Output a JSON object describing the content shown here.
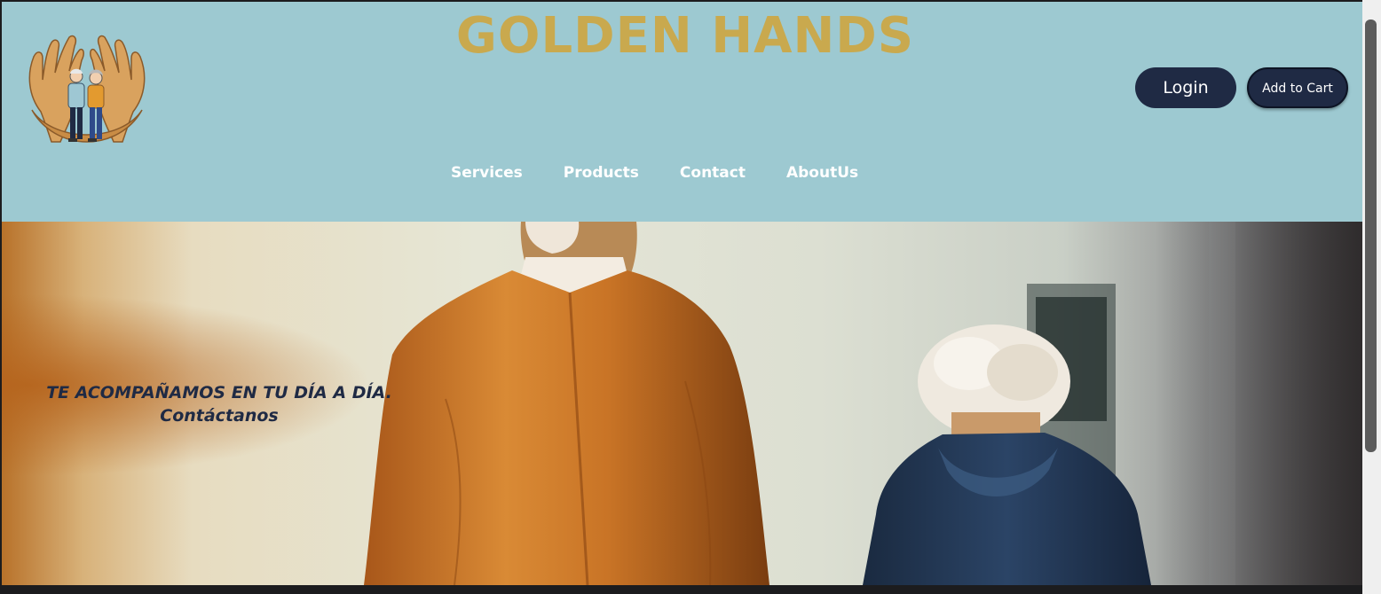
{
  "header": {
    "brand_title": "GOLDEN HANDS",
    "login_label": "Login",
    "cart_label": "Add to Cart",
    "logo_icon": "caring-hands-elderly-couple-logo"
  },
  "nav": {
    "items": [
      {
        "label": "Services"
      },
      {
        "label": "Products"
      },
      {
        "label": "Contact"
      },
      {
        "label": "AboutUs"
      }
    ]
  },
  "hero": {
    "headline": "TE ACOMPAÑAMOS EN TU DÍA A DÍA.",
    "cta_text": "Contáctanos"
  },
  "colors": {
    "header_bg": "#9dc9d1",
    "brand_gold": "#c9a94e",
    "button_navy": "#1f2a44",
    "nav_text": "#ffffff"
  }
}
